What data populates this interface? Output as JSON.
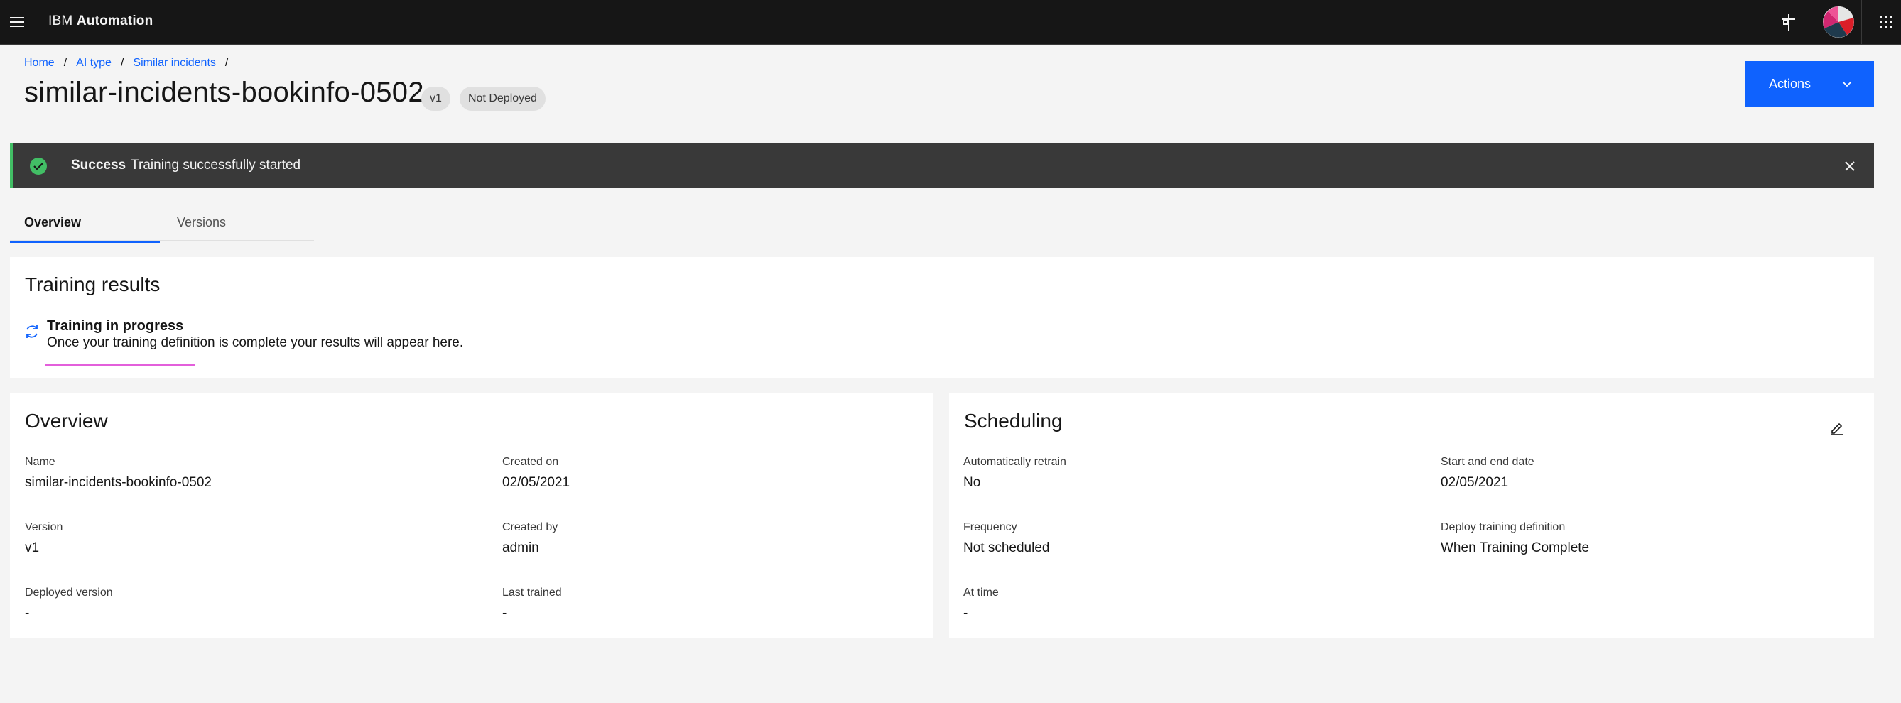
{
  "header": {
    "brand_prefix": "IBM",
    "brand_name": "Automation",
    "icons": [
      "menu-icon",
      "pin-icon",
      "avatar",
      "app-switcher-icon"
    ]
  },
  "breadcrumb": [
    {
      "label": "Home"
    },
    {
      "label": "AI type"
    },
    {
      "label": "Similar incidents"
    }
  ],
  "breadcrumb_sep": "/",
  "page": {
    "title": "similar-incidents-bookinfo-0502",
    "version_tag": "v1",
    "status_tag": "Not Deployed",
    "actions_label": "Actions"
  },
  "notification": {
    "title": "Success",
    "message": "Training successfully started",
    "kind": "success",
    "color": "#42be65"
  },
  "tabs": [
    {
      "label": "Overview",
      "selected": true
    },
    {
      "label": "Versions",
      "selected": false
    }
  ],
  "training_results": {
    "title": "Training results",
    "status_title": "Training in progress",
    "status_desc": "Once your training definition is complete your results will appear here.",
    "progress_color": "#e35fdb"
  },
  "overview": {
    "title": "Overview",
    "fields": [
      {
        "label": "Name",
        "value": "similar-incidents-bookinfo-0502"
      },
      {
        "label": "Created on",
        "value": "02/05/2021"
      },
      {
        "label": "Version",
        "value": "v1"
      },
      {
        "label": "Created by",
        "value": "admin"
      },
      {
        "label": "Deployed version",
        "value": "-"
      },
      {
        "label": "Last trained",
        "value": "-"
      }
    ]
  },
  "scheduling": {
    "title": "Scheduling",
    "fields": [
      {
        "label": "Automatically retrain",
        "value": "No"
      },
      {
        "label": "Start and end date",
        "value": "02/05/2021"
      },
      {
        "label": "Frequency",
        "value": "Not scheduled"
      },
      {
        "label": "Deploy training definition",
        "value": "When Training Complete"
      },
      {
        "label": "At time",
        "value": "-"
      }
    ]
  },
  "colors": {
    "accent": "#0f62fe",
    "header_bg": "#161616",
    "success": "#42be65"
  }
}
